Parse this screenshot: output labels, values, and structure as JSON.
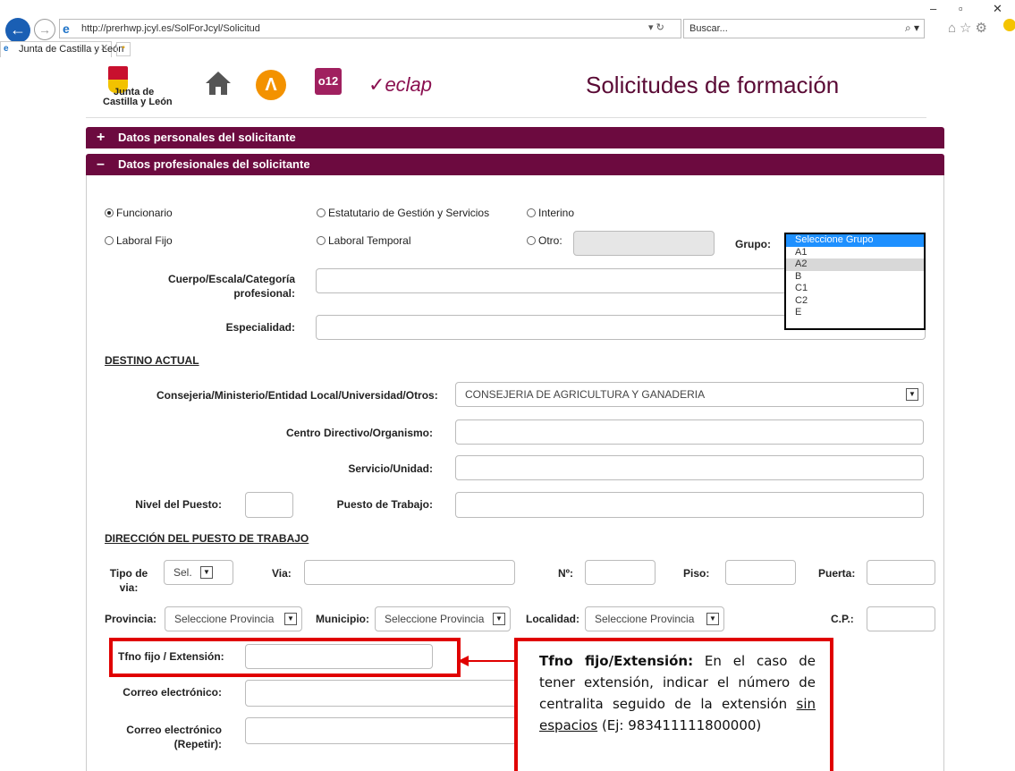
{
  "browser": {
    "url": "http://prerhwp.jcyl.es/SolForJcyl/Solicitud",
    "search_placeholder": "Buscar...",
    "tab_title": "Junta de Castilla y León",
    "refresh_glyph": "▾ ↻",
    "search_glyph": "⌕ ▾",
    "window_min": "–",
    "window_restore": "▫",
    "window_close": "✕",
    "back_glyph": "←",
    "forward_glyph": "→",
    "tab_close": "✕",
    "tool_icons": "⌂☆⚙"
  },
  "header": {
    "logo_text_line1": "Junta de",
    "logo_text_line2": "Castilla y León",
    "lambda_glyph": "Λ",
    "o12_text": "o12",
    "eclap_text": "eclap",
    "title": "Solicitudes de formación"
  },
  "sections": {
    "personal": {
      "icon": "+",
      "label": "Datos personales del solicitante"
    },
    "professional": {
      "icon": "–",
      "label": "Datos profesionales del solicitante"
    }
  },
  "radios": {
    "funcionario": "Funcionario",
    "estatutario": "Estatutario de Gestión y Servicios",
    "interino": "Interino",
    "laboral_fijo": "Laboral Fijo",
    "laboral_temporal": "Laboral Temporal",
    "otro": "Otro:",
    "selected": "Funcionario"
  },
  "fields": {
    "grupo_label": "Grupo:",
    "cuerpo_label_1": "Cuerpo/Escala/Categoría",
    "cuerpo_label_2": "profesional:",
    "especialidad_label": "Especialidad:",
    "destino_heading": "DESTINO ACTUAL",
    "consejeria_label": "Consejeria/Ministerio/Entidad Local/Universidad/Otros:",
    "consejeria_value": "CONSEJERIA DE AGRICULTURA Y GANADERIA",
    "centro_label": "Centro Directivo/Organismo:",
    "servicio_label": "Servicio/Unidad:",
    "nivel_label": "Nivel del Puesto:",
    "puesto_label": "Puesto de Trabajo:",
    "direccion_heading": "DIRECCIÓN DEL PUESTO DE TRABAJO",
    "tipo_via_label_1": "Tipo de",
    "tipo_via_label_2": "via:",
    "tipo_via_value": "Sel.",
    "via_label": "Via:",
    "numero_label": "Nº:",
    "piso_label": "Piso:",
    "puerta_label": "Puerta:",
    "provincia_label": "Provincia:",
    "provincia_value": "Seleccione Provincia",
    "municipio_label": "Municipio:",
    "municipio_value": "Seleccione Provincia",
    "localidad_label": "Localidad:",
    "localidad_value": "Seleccione Provincia",
    "cp_label": "C.P.:",
    "tfno_label": "Tfno fijo / Extensión:",
    "correo_label": "Correo electrónico:",
    "correo2_label_1": "Correo electrónico",
    "correo2_label_2": "(Repetir):"
  },
  "grupo_options": [
    "Seleccione Grupo",
    "A1",
    "A2",
    "B",
    "C1",
    "C2",
    "E"
  ],
  "grupo_highlighted": "Seleccione Grupo",
  "grupo_hovered": "A2",
  "callout": {
    "bold": "Tfno fijo/Extensión:",
    "text1": " En el caso de tener extensión, indicar el número de centralita seguido de la extensión ",
    "underlined": "sin espacios",
    "text2": " (Ej: 983411111800000)"
  },
  "colors": {
    "section_bar": "#6c0a3f",
    "title": "#5a0a35",
    "callout_border": "#e00000",
    "dropdown_highlight": "#1e90ff"
  }
}
